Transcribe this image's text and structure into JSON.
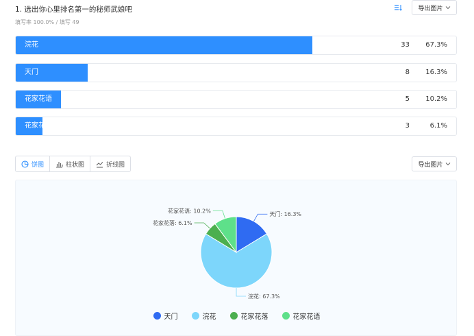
{
  "question": {
    "title": "1. 选出你心里排名第一的秘师武娘吧",
    "stats": "填写率 100.0% / 填写 49"
  },
  "toolbar": {
    "export_label": "导出图片"
  },
  "results": [
    {
      "label": "浣花",
      "count": "33",
      "percent": "67.3%",
      "fraction": 0.673
    },
    {
      "label": "天门",
      "count": "8",
      "percent": "16.3%",
      "fraction": 0.163
    },
    {
      "label": "花家花语",
      "count": "5",
      "percent": "10.2%",
      "fraction": 0.102
    },
    {
      "label": "花家花落",
      "count": "3",
      "percent": "6.1%",
      "fraction": 0.061
    }
  ],
  "chart_tabs": [
    {
      "label": "饼图",
      "active": true
    },
    {
      "label": "柱状图",
      "active": false
    },
    {
      "label": "折线图",
      "active": false
    }
  ],
  "colors": {
    "accent": "#2e8fff",
    "tianmen": "#2f6bf2",
    "huanhua": "#7dd6fb",
    "huajiahualuo": "#4caf50",
    "huajiahuayu": "#5ee08a"
  },
  "chart_data": {
    "type": "pie",
    "title": "",
    "slices": [
      {
        "name": "天门",
        "value": 16.3,
        "label": "天门: 16.3%",
        "color": "#2f6bf2"
      },
      {
        "name": "浣花",
        "value": 67.3,
        "label": "浣花: 67.3%",
        "color": "#7dd6fb"
      },
      {
        "name": "花家花落",
        "value": 6.1,
        "label": "花家花落: 6.1%",
        "color": "#4caf50"
      },
      {
        "name": "花家花语",
        "value": 10.2,
        "label": "花家花语: 10.2%",
        "color": "#5ee08a"
      }
    ],
    "legend": [
      "天门",
      "浣花",
      "花家花落",
      "花家花语"
    ],
    "legend_position": "bottom"
  }
}
